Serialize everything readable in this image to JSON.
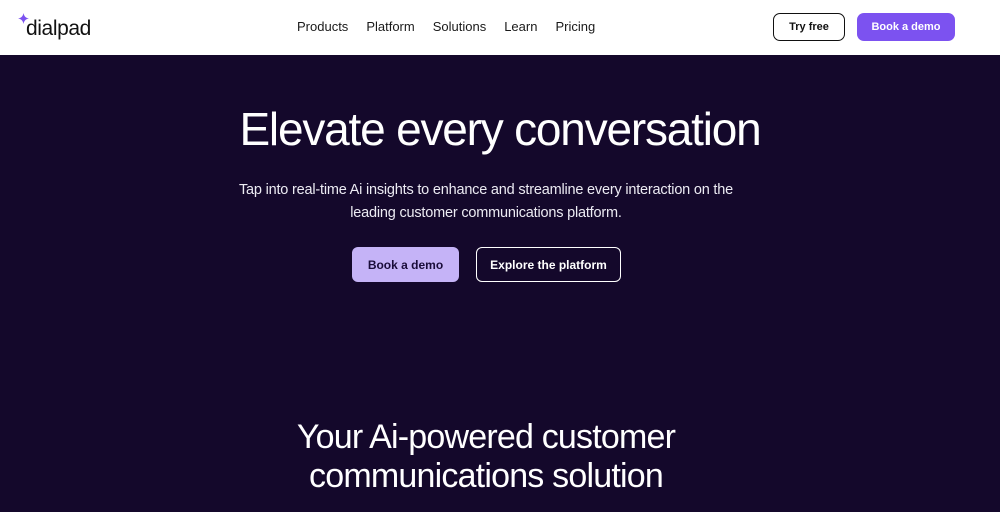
{
  "brand": {
    "name": "dialpad",
    "accent": "#7c52f0",
    "accent_light": "#c5b3f7",
    "background": "#14082b"
  },
  "nav": {
    "links": [
      "Products",
      "Platform",
      "Solutions",
      "Learn",
      "Pricing"
    ],
    "try_free": "Try free",
    "book_demo": "Book a demo"
  },
  "hero": {
    "title": "Elevate every conversation",
    "subtitle_line1": "Tap into real-time Ai insights to enhance and streamline every interaction on the",
    "subtitle_line2": "leading customer communications platform.",
    "primary_cta": "Book a demo",
    "secondary_cta": "Explore the platform"
  },
  "section": {
    "heading_line1": "Your Ai-powered customer",
    "heading_line2": "communications solution"
  }
}
